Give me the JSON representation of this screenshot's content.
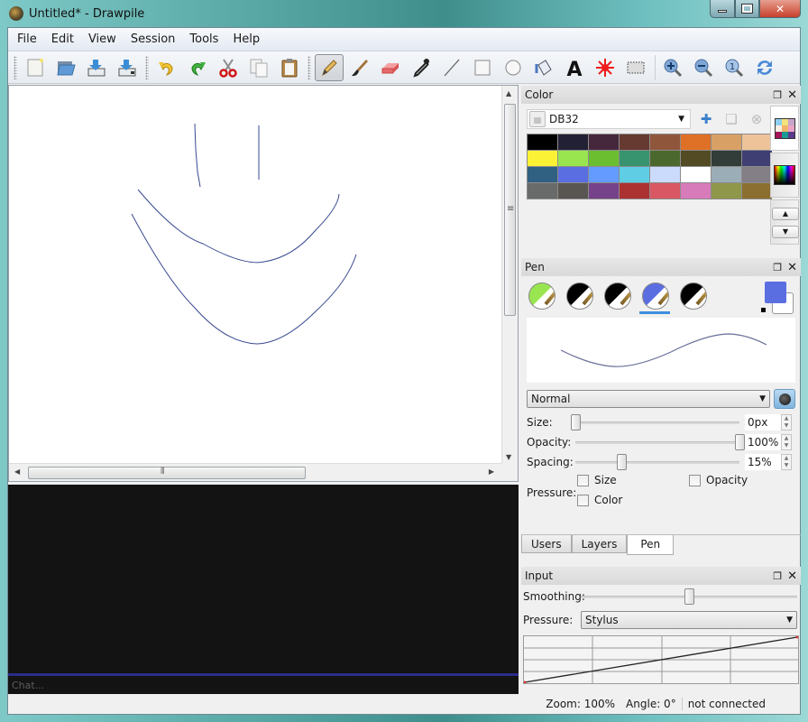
{
  "window": {
    "title": "Untitled* - Drawpile",
    "controls": {
      "minimize": "minimize",
      "maximize": "maximize",
      "close": "close"
    }
  },
  "menu": [
    {
      "label": "File"
    },
    {
      "label": "Edit"
    },
    {
      "label": "View"
    },
    {
      "label": "Session"
    },
    {
      "label": "Tools"
    },
    {
      "label": "Help"
    }
  ],
  "toolbar": {
    "file_actions": [
      "new-icon",
      "open-icon",
      "save-icon",
      "save-as-icon"
    ],
    "edit_actions": [
      "undo-icon",
      "redo-icon",
      "cut-icon",
      "copy-icon",
      "paste-icon"
    ],
    "tools": [
      "pencil-icon",
      "brush-icon",
      "eraser-icon",
      "color-picker-icon",
      "line-icon",
      "rectangle-icon",
      "ellipse-icon",
      "fill-icon",
      "text-icon",
      "laser-pointer-icon",
      "selection-icon"
    ],
    "active_tool": "pencil-icon",
    "view_actions": [
      "zoom-in-icon",
      "zoom-out-icon",
      "zoom-reset-icon",
      "rotate-reset-icon"
    ]
  },
  "canvas": {
    "stroke_color": "#3a4a90"
  },
  "chat": {
    "placeholder": "Chat..."
  },
  "status": {
    "zoom": "Zoom: 100%",
    "angle": "Angle: 0°",
    "connection": "not connected"
  },
  "color_dock": {
    "title": "Color",
    "palette_name": "DB32",
    "swatches": [
      "#000000",
      "#222034",
      "#45283c",
      "#663931",
      "#8f563b",
      "#df7126",
      "#d9a066",
      "#eec39a",
      "#fbf236",
      "#99e550",
      "#6abe30",
      "#37946e",
      "#4b692f",
      "#524b24",
      "#323c39",
      "#3f3f74",
      "#306082",
      "#5b6ee1",
      "#639bff",
      "#5fcde4",
      "#cbdbfc",
      "#ffffff",
      "#9badb7",
      "#847e87",
      "#696a6a",
      "#595652",
      "#76428a",
      "#ac3232",
      "#d95763",
      "#d77bba",
      "#8f974a",
      "#8a6f30"
    ]
  },
  "pen_dock": {
    "title": "Pen",
    "presets": [
      {
        "name": "preset-1",
        "color": "#99e550"
      },
      {
        "name": "preset-2",
        "color": "#000000"
      },
      {
        "name": "preset-3",
        "color": "#000000"
      },
      {
        "name": "preset-4",
        "color": "#5b6ee1"
      },
      {
        "name": "preset-5",
        "color": "#000000"
      }
    ],
    "selected_preset": 3,
    "foreground": "#5b6ee1",
    "background": "#ffffff",
    "blend_mode": "Normal",
    "size": {
      "label": "Size:",
      "value": "0px",
      "fraction": 0.0
    },
    "opacity": {
      "label": "Opacity:",
      "value": "100%",
      "fraction": 1.0
    },
    "spacing": {
      "label": "Spacing:",
      "value": "15%",
      "fraction": 0.28
    },
    "pressure_label": "Pressure:",
    "pressure_size": "Size",
    "pressure_opacity": "Opacity",
    "pressure_color": "Color"
  },
  "dock_tabs": [
    {
      "label": "Users"
    },
    {
      "label": "Layers"
    },
    {
      "label": "Pen",
      "selected": true
    }
  ],
  "input_dock": {
    "title": "Input",
    "smoothing_label": "Smoothing:",
    "smoothing_fraction": 0.5,
    "pressure_label": "Pressure:",
    "pressure_mode": "Stylus"
  }
}
